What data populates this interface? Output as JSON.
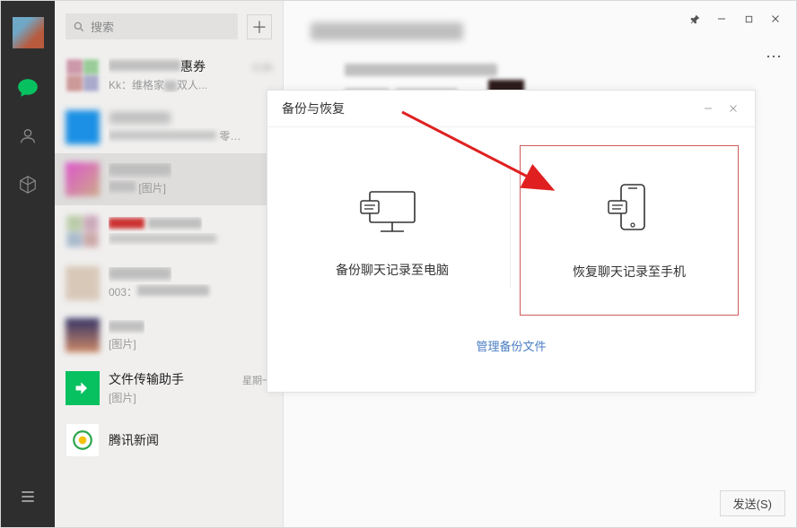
{
  "search": {
    "placeholder": "搜索"
  },
  "chatlist": {
    "item0_sub_prefix": "Kk：维格家",
    "item0_sub_suffix": "惠券",
    "item0_sub_tail": "双人...",
    "item6_name": "文件传输助手",
    "item6_sub": "[图片]",
    "item6_time": "星期一",
    "item7_name": "腾讯新闻",
    "pic_label": "[图片]"
  },
  "dialog": {
    "title": "备份与恢复",
    "backup_label": "备份聊天记录至电脑",
    "restore_label": "恢复聊天记录至手机",
    "manage_label": "管理备份文件"
  },
  "send_button": "发送(S)"
}
